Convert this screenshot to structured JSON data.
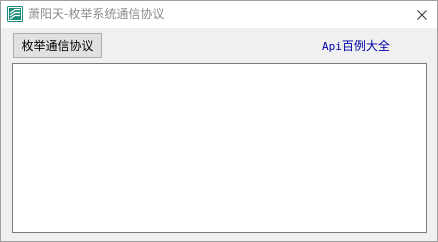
{
  "window": {
    "title": "萧阳天-枚举系统通信协议",
    "app_icon": "app-logo-icon",
    "close_icon": "close-icon"
  },
  "toolbar": {
    "enum_protocol_label": "枚举通信协议",
    "api_link_prefix": "Api",
    "api_link_suffix": "百例大全"
  },
  "output": {
    "value": ""
  },
  "colors": {
    "link": "#0000aa",
    "title_text": "#8c8c8c",
    "icon_teal": "#1e8c7a"
  }
}
